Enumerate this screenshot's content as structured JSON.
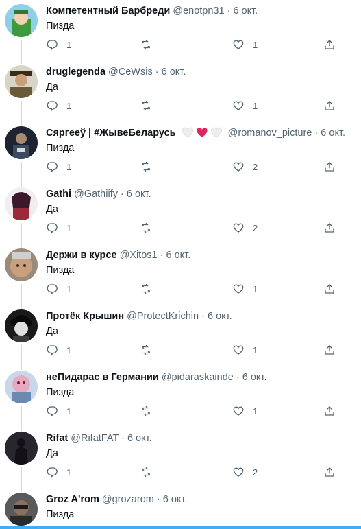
{
  "tweets": [
    {
      "name": "Компетентный Барбреди",
      "handle": "@enotpn31",
      "date": "6 окт.",
      "text": "Пизда",
      "replies": "1",
      "retweets": "",
      "likes": "1",
      "avatar_color": "#4fa84f"
    },
    {
      "name": "druglegenda",
      "handle": "@CeWsis",
      "date": "6 окт.",
      "text": "Да",
      "replies": "1",
      "retweets": "",
      "likes": "1",
      "avatar_color": "#7a6a45"
    },
    {
      "name": "Сяргееў | #ЖывеБеларусь",
      "handle": "@romanov_picture",
      "date": "6 окт.",
      "text": "Пизда",
      "replies": "1",
      "retweets": "",
      "likes": "2",
      "avatar_color": "#2b2f3a"
    },
    {
      "name": "Gathi",
      "handle": "@Gathiify",
      "date": "6 окт.",
      "text": "Да",
      "replies": "1",
      "retweets": "",
      "likes": "2",
      "avatar_color": "#8a3a4a"
    },
    {
      "name": "Держи в курсе",
      "handle": "@Xitos1",
      "date": "6 окт.",
      "text": "Пизда",
      "replies": "1",
      "retweets": "",
      "likes": "1",
      "avatar_color": "#b78d6b"
    },
    {
      "name": "Протёк Крышин",
      "handle": "@ProtectKrichin",
      "date": "6 окт.",
      "text": "Да",
      "replies": "1",
      "retweets": "",
      "likes": "1",
      "avatar_color": "#2a2a2a"
    },
    {
      "name": "неПидарас в Германии",
      "handle": "@pidaraskainde",
      "date": "6 окт.",
      "text": "Пизда",
      "replies": "1",
      "retweets": "",
      "likes": "1",
      "avatar_color": "#d98fa6"
    },
    {
      "name": "Rifat",
      "handle": "@RifatFAT",
      "date": "6 окт.",
      "text": "Да",
      "replies": "1",
      "retweets": "",
      "likes": "2",
      "avatar_color": "#3b3344"
    },
    {
      "name": "Groz A'rom",
      "handle": "@grozarom",
      "date": "6 окт.",
      "text": "Пизда",
      "replies": "",
      "retweets": "",
      "likes": "",
      "avatar_color": "#4a4a4a"
    }
  ],
  "dot": "·",
  "icons": {
    "reply": "reply-icon",
    "retweet": "retweet-icon",
    "like": "heart-icon",
    "share": "share-icon"
  },
  "colors": {
    "meta": "#536471",
    "line": "#cfd9de",
    "heart_red": "#e0245e"
  }
}
